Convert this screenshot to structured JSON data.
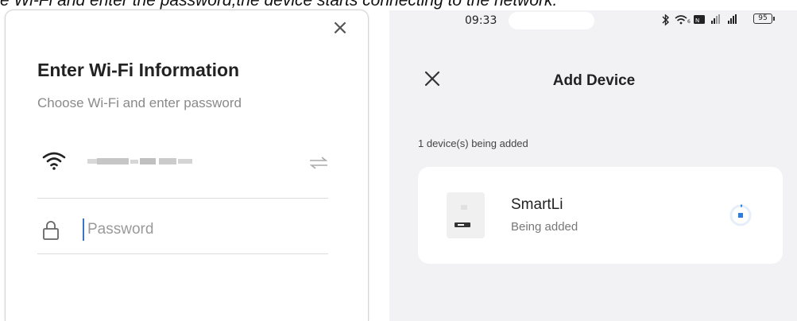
{
  "caption": "e Wi-Fi and enter the password,the device starts connecting to the network.",
  "left_panel": {
    "title": "Enter Wi-Fi Information",
    "subtitle": "Choose Wi-Fi and enter password",
    "wifi_name_obscured": true,
    "password_placeholder": "Password",
    "password_value": "",
    "icons": [
      "close-icon",
      "wifi-icon",
      "switch-network-icon",
      "lock-icon"
    ]
  },
  "right_panel": {
    "status_bar": {
      "time": "09:33",
      "battery": "95"
    },
    "title": "Add Device",
    "devices_being_added": "1 device(s) being added",
    "device": {
      "name": "SmartLi",
      "status": "Being added"
    },
    "accent_color": "#2a7de1",
    "icons": [
      "close-icon",
      "bluetooth-icon",
      "wifi-icon",
      "nfc-icon",
      "signal-icon",
      "battery-icon",
      "loading-spinner-icon"
    ]
  }
}
